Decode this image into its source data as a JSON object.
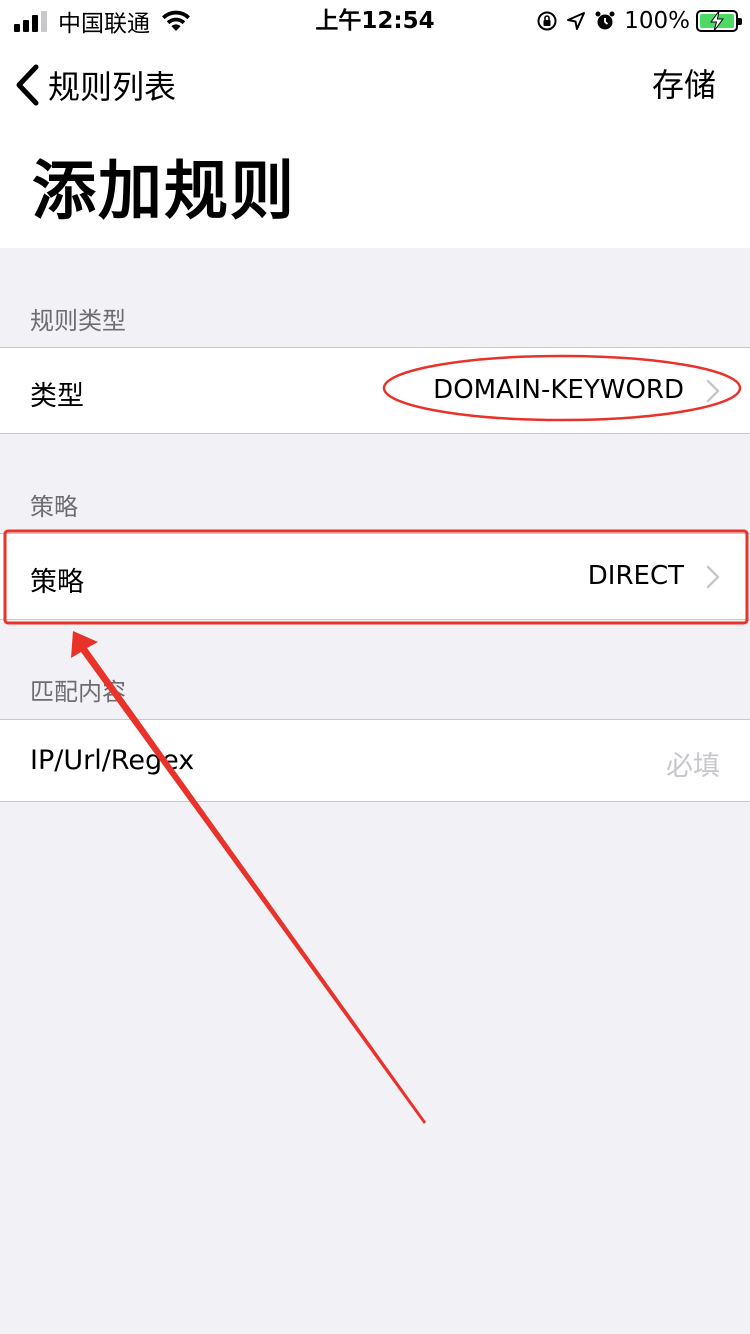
{
  "status_bar": {
    "carrier": "中国联通",
    "time": "上午12:54",
    "battery_percent": "100%",
    "signal_bars_filled": 3,
    "signal_bars_total": 4,
    "icons": [
      "signal-icon",
      "wifi-icon",
      "orientation-lock-icon",
      "location-icon",
      "alarm-icon",
      "battery-charging-icon"
    ]
  },
  "nav": {
    "back_label": "规则列表",
    "save_label": "存储",
    "title": "添加规则"
  },
  "sections": {
    "rule_type": {
      "header": "规则类型",
      "label": "类型",
      "value": "DOMAIN-KEYWORD"
    },
    "policy": {
      "header": "策略",
      "label": "策略",
      "value": "DIRECT"
    },
    "match": {
      "header": "匹配内容",
      "label": "IP/Url/Regex",
      "placeholder": "必填"
    }
  },
  "annotations": {
    "color": "#e8322a",
    "marks": [
      "ellipse-around-type-value",
      "rectangle-around-policy-cell",
      "arrow-to-policy-cell"
    ]
  }
}
